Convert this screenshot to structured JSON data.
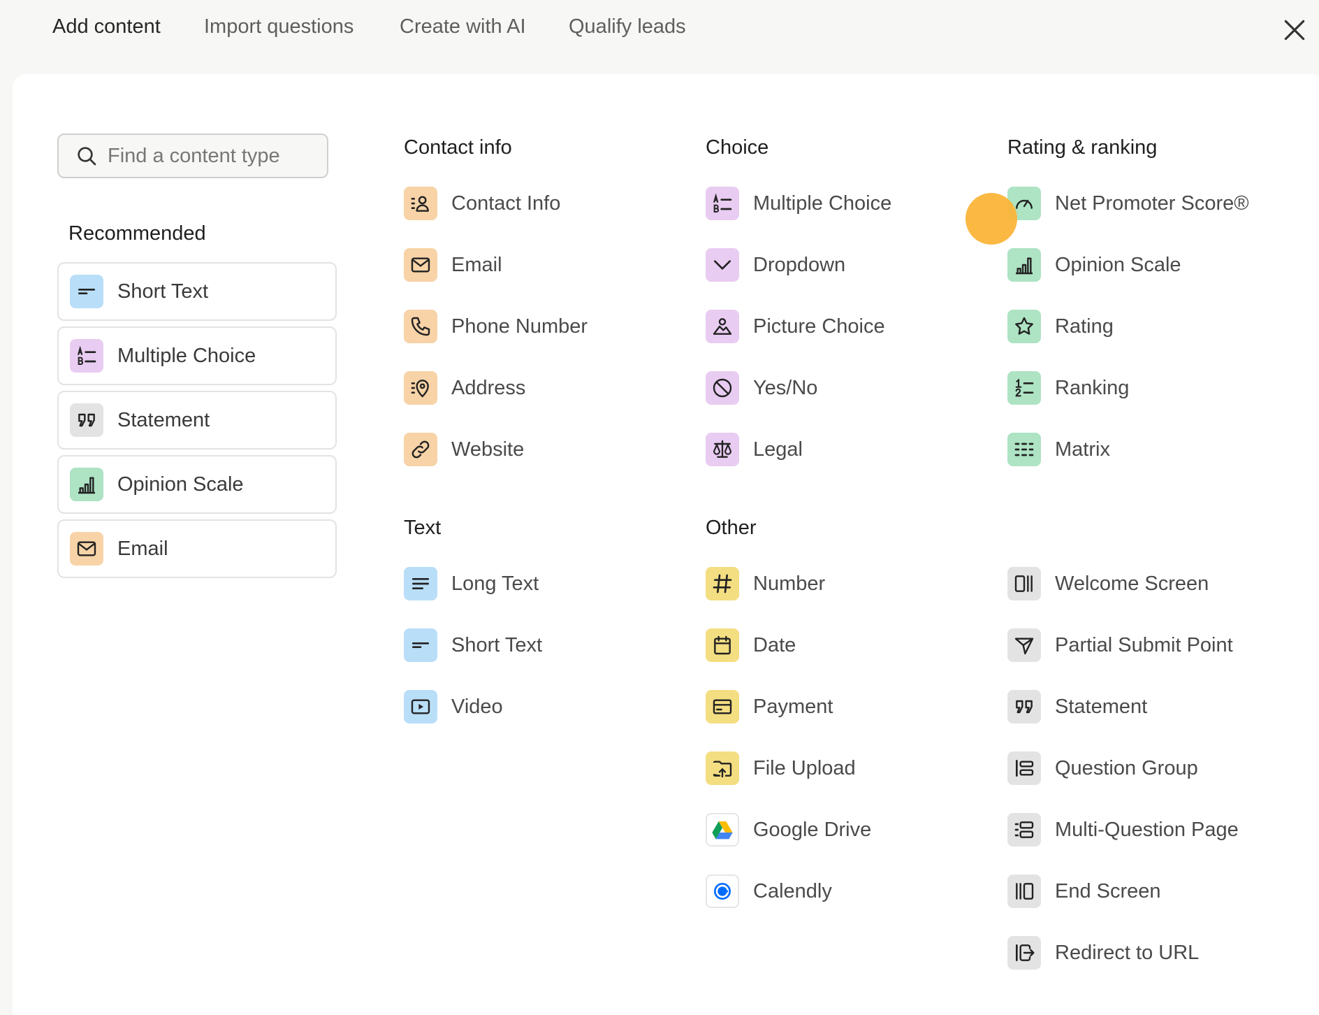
{
  "tabs": [
    {
      "label": "Add content",
      "active": true
    },
    {
      "label": "Import questions",
      "active": false
    },
    {
      "label": "Create with AI",
      "active": false
    },
    {
      "label": "Qualify leads",
      "active": false
    }
  ],
  "search": {
    "placeholder": "Find a content type",
    "value": ""
  },
  "recommended": {
    "title": "Recommended",
    "items": [
      {
        "label": "Short Text",
        "icon": "short-text-icon",
        "color": "#b9def8"
      },
      {
        "label": "Multiple Choice",
        "icon": "multiple-choice-icon",
        "color": "#e9ccf1"
      },
      {
        "label": "Statement",
        "icon": "quote-icon",
        "color": "#e3e3e3"
      },
      {
        "label": "Opinion Scale",
        "icon": "bar-chart-icon",
        "color": "#aee3c4"
      },
      {
        "label": "Email",
        "icon": "mail-icon",
        "color": "#f7d3a7"
      }
    ]
  },
  "sections": {
    "contact": {
      "title": "Contact info",
      "items": [
        {
          "label": "Contact Info",
          "icon": "contact-card-icon"
        },
        {
          "label": "Email",
          "icon": "mail-icon"
        },
        {
          "label": "Phone Number",
          "icon": "phone-icon"
        },
        {
          "label": "Address",
          "icon": "location-pin-icon"
        },
        {
          "label": "Website",
          "icon": "link-icon"
        }
      ]
    },
    "choice": {
      "title": "Choice",
      "items": [
        {
          "label": "Multiple Choice",
          "icon": "multiple-choice-icon"
        },
        {
          "label": "Dropdown",
          "icon": "chevron-down-icon"
        },
        {
          "label": "Picture Choice",
          "icon": "picture-icon"
        },
        {
          "label": "Yes/No",
          "icon": "yes-no-icon"
        },
        {
          "label": "Legal",
          "icon": "scales-icon"
        }
      ]
    },
    "rating": {
      "title": "Rating & ranking",
      "items": [
        {
          "label": "Net Promoter Score®",
          "icon": "gauge-icon"
        },
        {
          "label": "Opinion Scale",
          "icon": "bar-chart-icon"
        },
        {
          "label": "Rating",
          "icon": "star-icon"
        },
        {
          "label": "Ranking",
          "icon": "ranking-list-icon"
        },
        {
          "label": "Matrix",
          "icon": "matrix-grid-icon"
        }
      ]
    },
    "text": {
      "title": "Text",
      "items": [
        {
          "label": "Long Text",
          "icon": "long-text-icon"
        },
        {
          "label": "Short Text",
          "icon": "short-text-icon"
        },
        {
          "label": "Video",
          "icon": "video-play-icon"
        }
      ]
    },
    "other": {
      "title": "Other",
      "items": [
        {
          "label": "Number",
          "icon": "hash-icon"
        },
        {
          "label": "Date",
          "icon": "calendar-icon"
        },
        {
          "label": "Payment",
          "icon": "credit-card-icon"
        },
        {
          "label": "File Upload",
          "icon": "file-upload-icon"
        },
        {
          "label": "Google Drive",
          "icon": "google-drive-icon"
        },
        {
          "label": "Calendly",
          "icon": "calendly-icon"
        }
      ]
    },
    "screens": {
      "items": [
        {
          "label": "Welcome Screen",
          "icon": "welcome-screen-icon"
        },
        {
          "label": "Partial Submit Point",
          "icon": "send-icon"
        },
        {
          "label": "Statement",
          "icon": "quote-icon"
        },
        {
          "label": "Question Group",
          "icon": "question-group-icon"
        },
        {
          "label": "Multi-Question Page",
          "icon": "multi-question-icon"
        },
        {
          "label": "End Screen",
          "icon": "end-screen-icon"
        },
        {
          "label": "Redirect to URL",
          "icon": "redirect-icon"
        }
      ]
    }
  },
  "colors": {
    "orange": "#f7d3a7",
    "purple": "#e9ccf1",
    "green": "#aee3c4",
    "blue": "#b9def8",
    "yellow": "#f4de82",
    "gray": "#e3e3e3",
    "cursor": "#fbb53a"
  }
}
